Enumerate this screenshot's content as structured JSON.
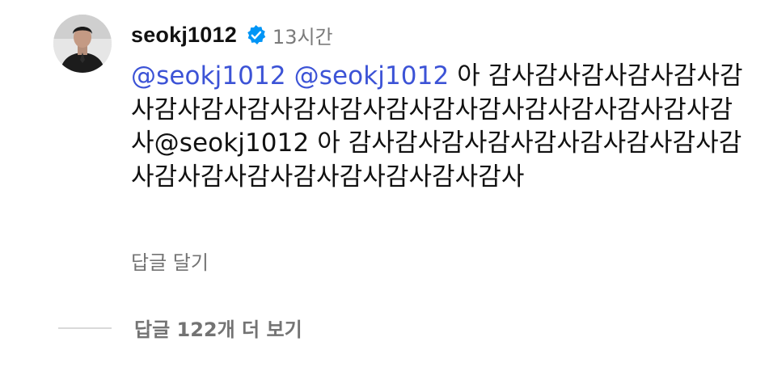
{
  "comment": {
    "username": "seokj1012",
    "verified_icon": "verified-badge-icon",
    "timestamp": "13시간",
    "segments": [
      {
        "type": "mention",
        "text": "@seokj1012"
      },
      {
        "type": "text",
        "text": " "
      },
      {
        "type": "mention",
        "text": "@seokj1012"
      },
      {
        "type": "text",
        "text": " 아 감사감사감사감사감사감사감사감사감사감사감사감사감사감사감사감사감사감사감사"
      },
      {
        "type": "text",
        "text": "@seokj1012 아 감사감사감사감사감사감사감사감사감사감사감사감사감사감사감사감사감사"
      }
    ],
    "reply_label": "답글 달기",
    "more_replies_label": "답글 122개 더 보기"
  },
  "colors": {
    "mention": "#3c53d6",
    "verified_badge": "#0095f6",
    "secondary_text": "#737373"
  }
}
